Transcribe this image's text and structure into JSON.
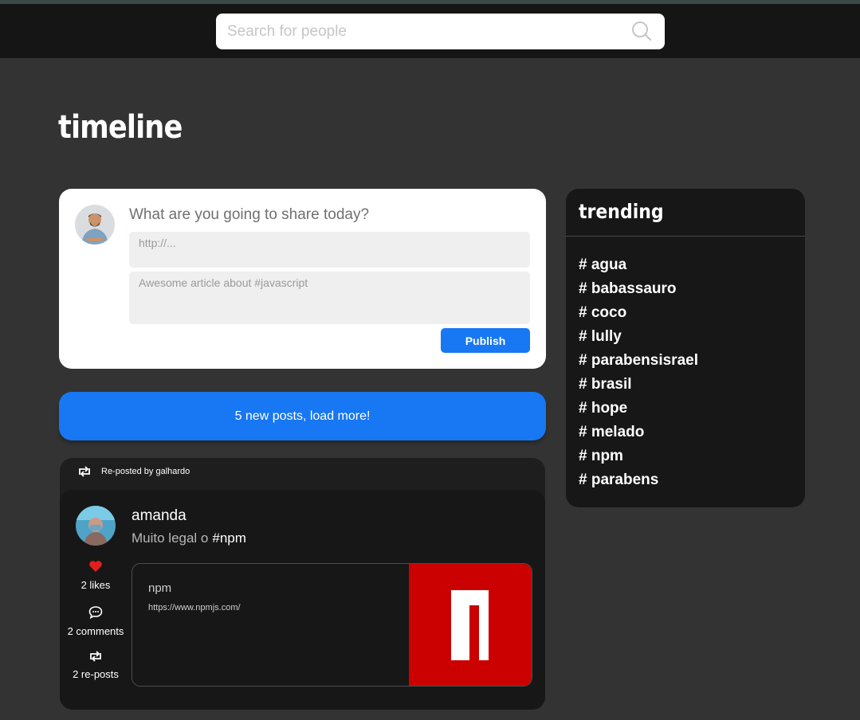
{
  "search": {
    "placeholder": "Search for people"
  },
  "page": {
    "title": "timeline"
  },
  "composer": {
    "prompt": "What are you going to share today?",
    "url_placeholder": "http://...",
    "text_placeholder": "Awesome article about #javascript",
    "publish_label": "Publish"
  },
  "load_more": {
    "label": "5 new posts, load more!"
  },
  "post": {
    "repost_label": "Re-posted by galhardo",
    "author": "amanda",
    "text": "Muito legal o",
    "hashtag": "#npm",
    "likes": "2 likes",
    "comments": "2 comments",
    "reposts": "2 re-posts",
    "liked": true,
    "link": {
      "title": "npm",
      "url": "https://www.npmjs.com/"
    }
  },
  "trending": {
    "title": "trending",
    "tags": [
      "# agua",
      "# babassauro",
      "# coco",
      "# lully",
      "# parabensisrael",
      "# brasil",
      "# hope",
      "# melado",
      "# npm",
      "# parabens"
    ]
  },
  "colors": {
    "accent": "#1877f2",
    "background": "#333333",
    "card": "#171717",
    "like": "#e02020",
    "npm_red": "#cb0000"
  }
}
